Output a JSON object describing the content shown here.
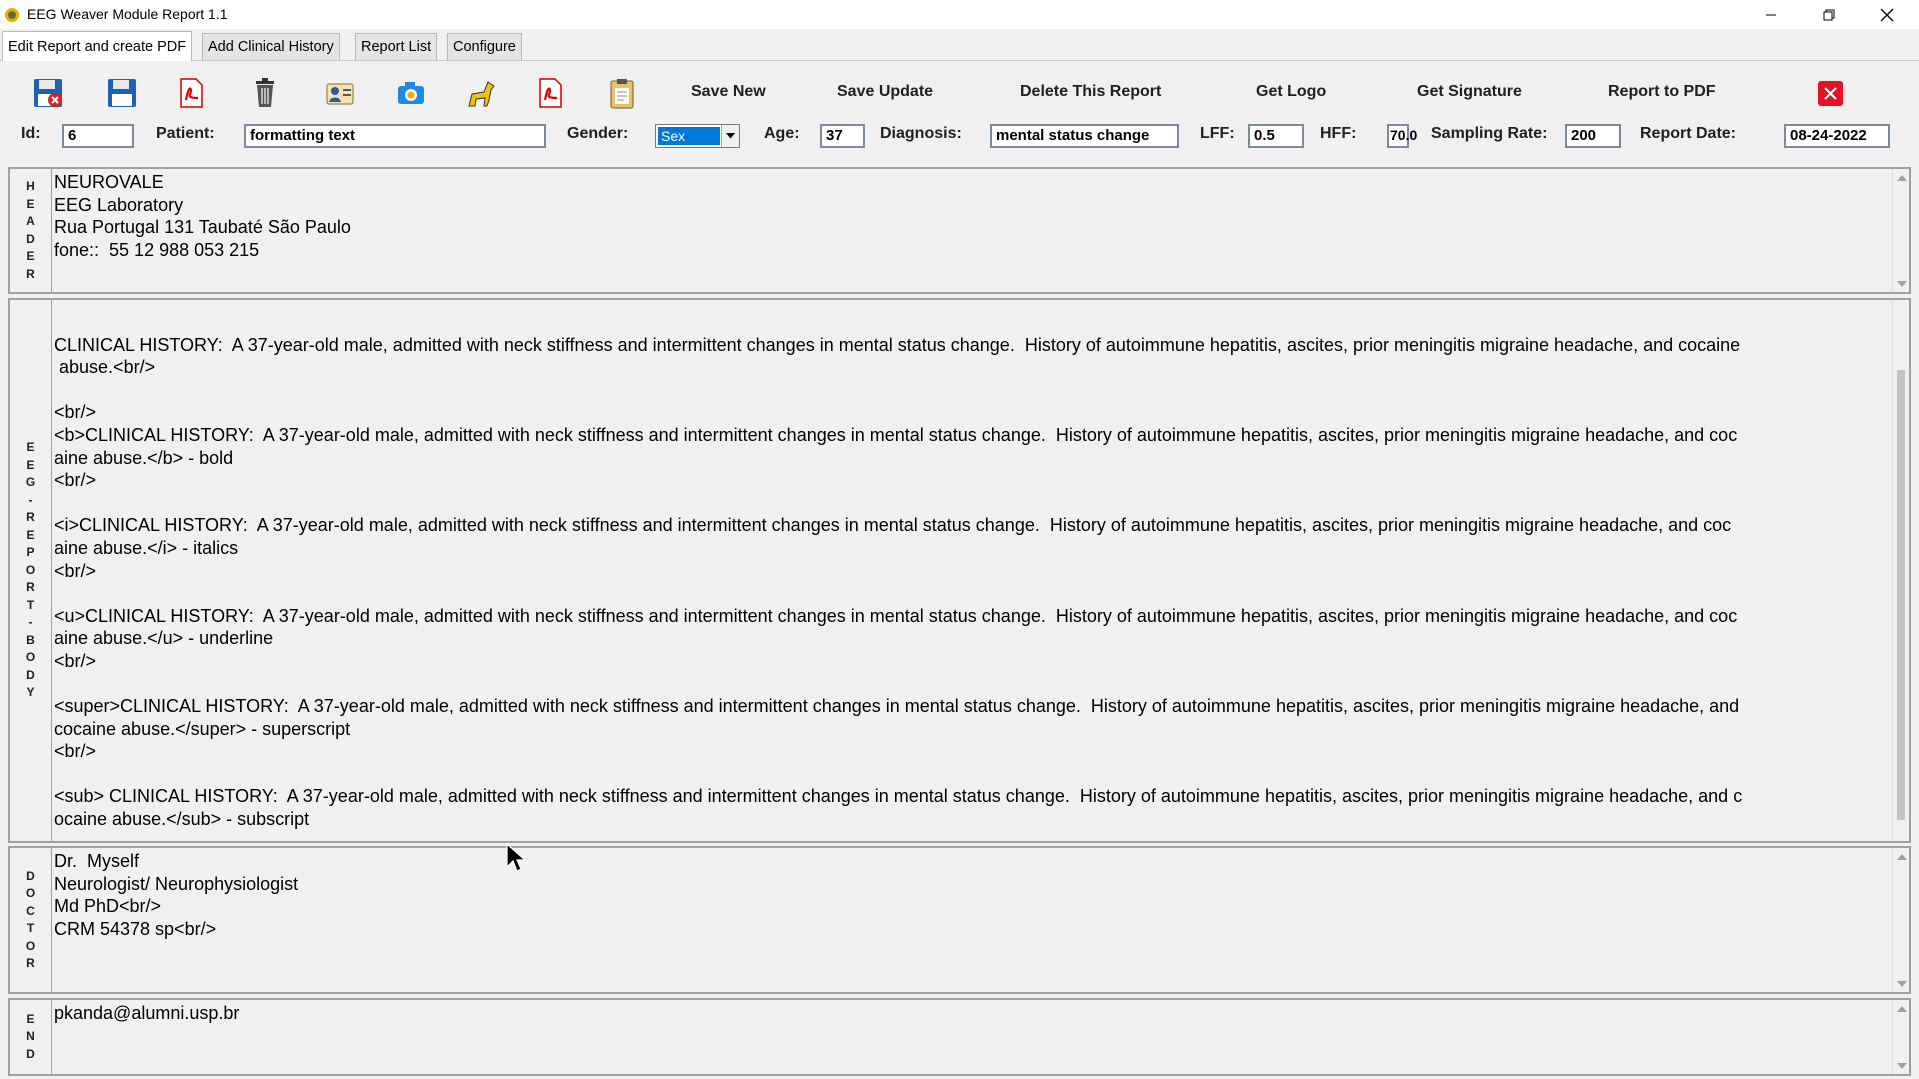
{
  "window": {
    "title": "EEG Weaver Module Report 1.1",
    "minimize_icon": "minimize-icon",
    "restore_icon": "restore-icon",
    "close_icon": "close-icon"
  },
  "tabs": [
    {
      "label": "Edit Report and create PDF",
      "active": true
    },
    {
      "label": "Add Clinical History",
      "active": false
    },
    {
      "label": "Report List",
      "active": false
    },
    {
      "label": "Configure",
      "active": false
    }
  ],
  "toolbar": {
    "icons": [
      "delete-report-floppy-icon",
      "save-floppy-icon",
      "pdf-icon",
      "trash-icon",
      "user-card-icon",
      "camera-icon",
      "horse-icon",
      "pdf-export-icon",
      "clipboard-icon"
    ],
    "save_new": "Save New",
    "save_update": "Save Update",
    "delete_report": "Delete This Report",
    "get_logo": "Get Logo",
    "get_signature": "Get Signature",
    "report_to_pdf": "Report to PDF",
    "close_icon": "red-close-icon"
  },
  "form": {
    "id_label": "Id:",
    "id_value": "6",
    "patient_label": "Patient:",
    "patient_value": "formatting text",
    "gender_label": "Gender:",
    "gender_value": "Sex",
    "age_label": "Age:",
    "age_value": "37",
    "diagnosis_label": "Diagnosis:",
    "diagnosis_value": "mental status change",
    "lff_label": "LFF:",
    "lff_value": "0.5",
    "hff_label": "HFF:",
    "hff_value": "70.0",
    "sampling_label": "Sampling Rate:",
    "sampling_value": "200",
    "report_date_label": "Report Date:",
    "report_date_value": "08-24-2022"
  },
  "panels": {
    "header": {
      "side_label": [
        "H",
        "E",
        "A",
        "D",
        "E",
        "R"
      ],
      "text": "NEUROVALE\nEEG Laboratory\nRua Portugal 131 Taubaté São Paulo\nfone::  55 12 988 053 215"
    },
    "body": {
      "side_label": [
        "E",
        "E",
        "G",
        "-",
        "R",
        "E",
        "P",
        "O",
        "R",
        "T",
        "-",
        "B",
        "O",
        "D",
        "Y"
      ],
      "text": "\nCLINICAL HISTORY:  A 37-year-old male, admitted with neck stiffness and intermittent changes in mental status change.  History of autoimmune hepatitis, ascites, prior meningitis migraine headache, and cocaine\n abuse.<br/>\n\n<br/>\n<b>CLINICAL HISTORY:  A 37-year-old male, admitted with neck stiffness and intermittent changes in mental status change.  History of autoimmune hepatitis, ascites, prior meningitis migraine headache, and coc\naine abuse.</b> - bold\n<br/>\n\n<i>CLINICAL HISTORY:  A 37-year-old male, admitted with neck stiffness and intermittent changes in mental status change.  History of autoimmune hepatitis, ascites, prior meningitis migraine headache, and coc\naine abuse.</i> - italics\n<br/>\n\n<u>CLINICAL HISTORY:  A 37-year-old male, admitted with neck stiffness and intermittent changes in mental status change.  History of autoimmune hepatitis, ascites, prior meningitis migraine headache, and coc\naine abuse.</u> - underline\n<br/>\n\n<super>CLINICAL HISTORY:  A 37-year-old male, admitted with neck stiffness and intermittent changes in mental status change.  History of autoimmune hepatitis, ascites, prior meningitis migraine headache, and\ncocaine abuse.</super> - superscript\n<br/>\n\n<sub> CLINICAL HISTORY:  A 37-year-old male, admitted with neck stiffness and intermittent changes in mental status change.  History of autoimmune hepatitis, ascites, prior meningitis migraine headache, and c\nocaine abuse.</sub> - subscript"
    },
    "doctor": {
      "side_label": [
        "D",
        "O",
        "C",
        "T",
        "O",
        "R"
      ],
      "text": "Dr.  Myself\nNeurologist/ Neurophysiologist\nMd PhD<br/>\nCRM 54378 sp<br/>"
    },
    "end": {
      "side_label": [
        "E",
        "N",
        "D"
      ],
      "text": "pkanda@alumni.usp.br"
    }
  },
  "colors": {
    "selection": "#0078d7",
    "close_red": "#e81123",
    "panel_bg": "#f0f0f0"
  }
}
